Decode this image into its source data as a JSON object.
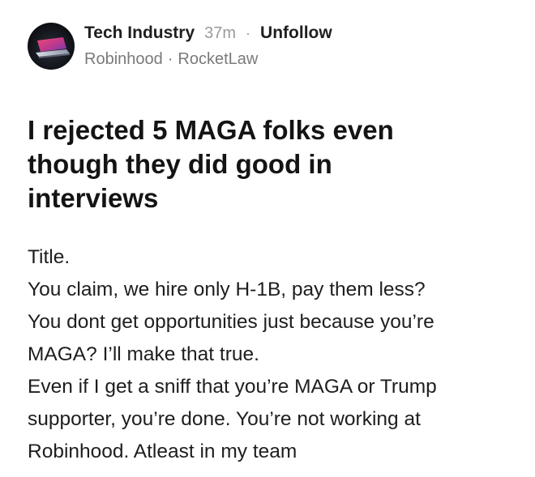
{
  "post": {
    "community": "Tech Industry",
    "time_ago": "37m",
    "separator": "·",
    "follow_action": "Unfollow",
    "tags": [
      "Robinhood",
      "RocketLaw"
    ],
    "tag_separator": "·",
    "title_lines": [
      "I rejected 5 MAGA folks even",
      "though they did good in",
      "interviews"
    ],
    "body_lines": [
      "Title.",
      "You claim, we hire only H-1B, pay them less?",
      "You dont get opportunities just because you’re",
      "MAGA? I’ll make that true.",
      "Even if I get a sniff that you’re MAGA or Trump",
      "supporter, you’re done. You’re not working at",
      "Robinhood. Atleast in my team"
    ]
  },
  "icons": {
    "avatar": "tech-industry-avatar"
  },
  "colors": {
    "text_primary": "#1c1c1c",
    "text_secondary": "#7a7a7a",
    "timestamp": "#9a9a9a",
    "background": "#ffffff"
  }
}
